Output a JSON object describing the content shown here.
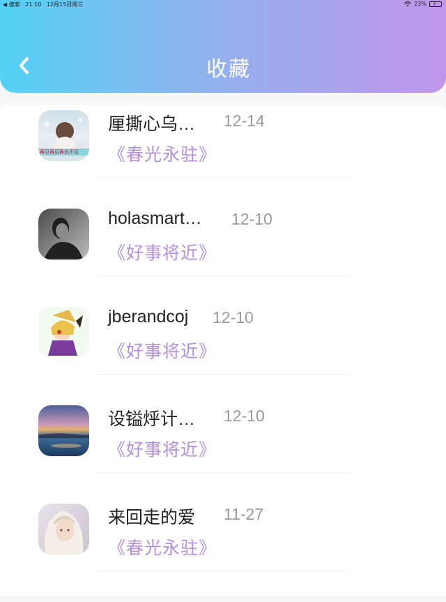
{
  "status_bar": {
    "back_app": "◀ 搜索",
    "time": "21:10",
    "date": "12月15日周三",
    "battery": "23%"
  },
  "header": {
    "title": "收藏",
    "back_icon": "chevron-left-icon"
  },
  "colors": {
    "header_gradient_start": "#53d2f5",
    "header_gradient_end": "#c196ea",
    "song_title": "#b68ee0",
    "date": "#9a9a9a"
  },
  "favorites": [
    {
      "username": "厘撕心乌…",
      "date": "12-14",
      "song": "《春光永驻》",
      "avatar_text": "再见再见再也不见"
    },
    {
      "username": "holasmart…",
      "date": "12-10",
      "song": "《好事将近》"
    },
    {
      "username": "jberandcoj",
      "date": "12-10",
      "song": "《好事将近》"
    },
    {
      "username": "设镒烀计…",
      "date": "12-10",
      "song": "《好事将近》"
    },
    {
      "username": "来回走的爱",
      "date": "11-27",
      "song": "《春光永驻》"
    }
  ]
}
